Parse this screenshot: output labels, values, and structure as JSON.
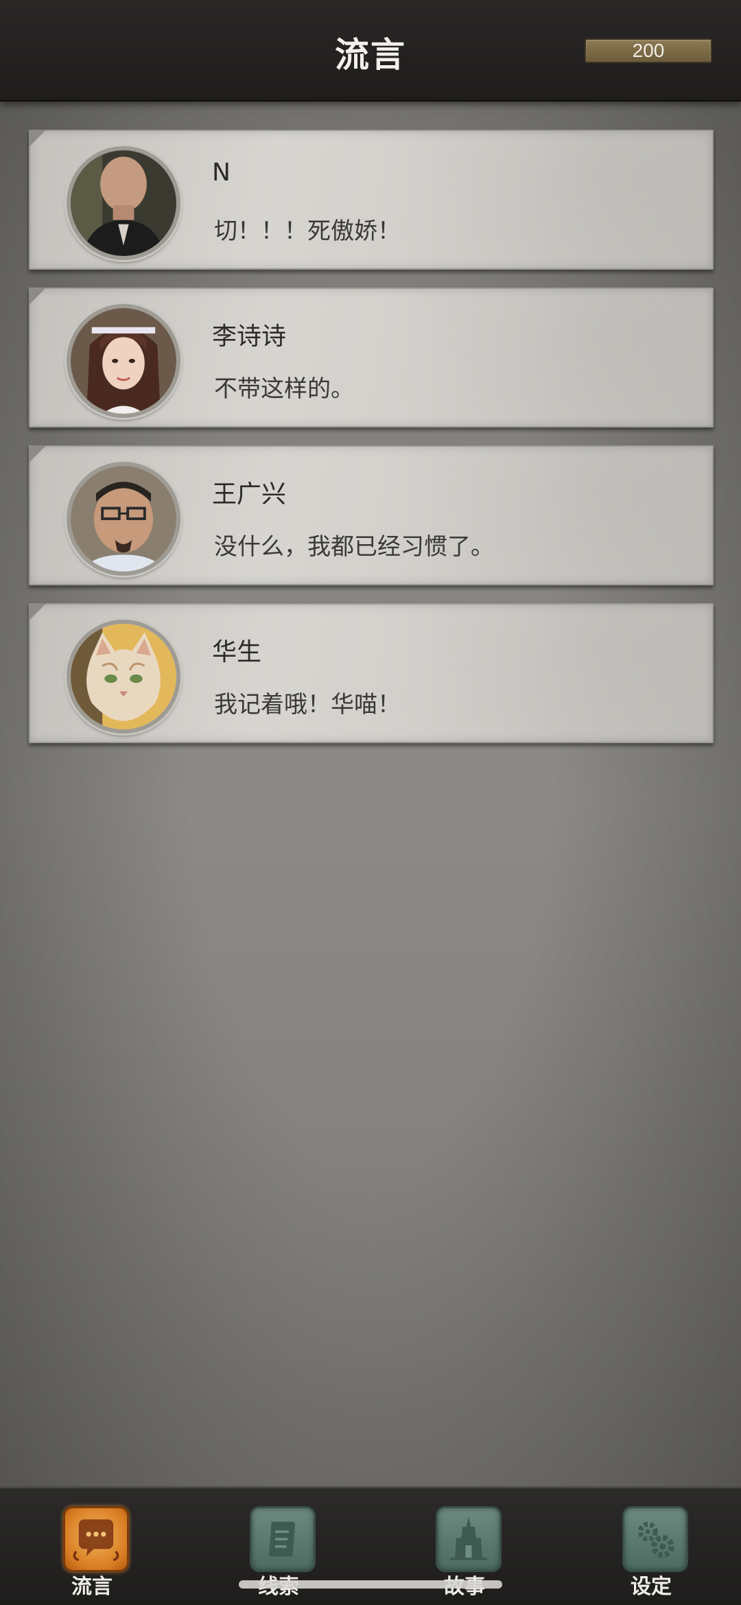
{
  "header": {
    "title": "流言",
    "coins": "200"
  },
  "rumors": [
    {
      "name": "N",
      "message": "切！！！死傲娇！"
    },
    {
      "name": "李诗诗",
      "message": "不带这样的。"
    },
    {
      "name": "王广兴",
      "message": "没什么，我都已经习惯了。"
    },
    {
      "name": "华生",
      "message": "我记着哦！华喵！"
    }
  ],
  "nav": [
    {
      "label": "流言",
      "icon": "chat-bubble-icon",
      "active": true
    },
    {
      "label": "线索",
      "icon": "scroll-icon",
      "active": false
    },
    {
      "label": "故事",
      "icon": "temple-icon",
      "active": false
    },
    {
      "label": "设定",
      "icon": "gears-icon",
      "active": false
    }
  ]
}
